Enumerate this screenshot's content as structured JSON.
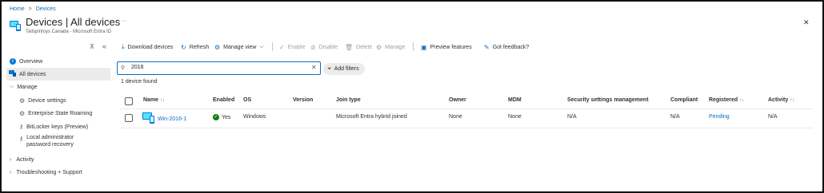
{
  "breadcrumb": {
    "home": "Home",
    "sep": ">",
    "devices": "Devices"
  },
  "header": {
    "title": "Devices | All devices",
    "more": "···",
    "subtitle": "Tailspintoys Canada - Microsoft Entra ID",
    "close": "✕"
  },
  "sidebar": {
    "pin": "⊼",
    "collapse": "«",
    "items": [
      {
        "label": "Overview"
      },
      {
        "label": "All devices"
      },
      {
        "label": "Manage"
      },
      {
        "label": "Device settings"
      },
      {
        "label": "Enterprise State Roaming"
      },
      {
        "label": "BitLocker keys (Preview)"
      },
      {
        "label": "Local administrator"
      },
      {
        "label": "password recovery"
      },
      {
        "label": "Activity"
      },
      {
        "label": "Troubleshooting + Support"
      }
    ]
  },
  "toolbar": {
    "download": "Download devices",
    "refresh": "Refresh",
    "manage_view": "Manage view",
    "enable": "Enable",
    "disable": "Disable",
    "delete": "Delete",
    "manage": "Manage",
    "preview_features": "Preview features",
    "feedback": "Got feedback?"
  },
  "search": {
    "value": "2016",
    "clear": "✕"
  },
  "filters": {
    "add_label": "Add filters"
  },
  "result_count": "1 device found",
  "table": {
    "headers": {
      "name": "Name",
      "enabled": "Enabled",
      "os": "OS",
      "version": "Version",
      "join_type": "Join type",
      "owner": "Owner",
      "mdm": "MDM",
      "security": "Security settings management",
      "compliant": "Compliant",
      "registered": "Registered",
      "activity": "Activity"
    },
    "sort_glyph": "↑↓",
    "rows": [
      {
        "name": "Win-2016-1",
        "enabled": "Yes",
        "os": "Windows",
        "version": "",
        "join_type": "Microsoft Entra hybrid joined",
        "owner": "None",
        "mdm": "None",
        "security": "N/A",
        "compliant": "N/A",
        "registered": "Pending",
        "activity": "N/A"
      }
    ]
  },
  "colors": {
    "accent": "#0f6cbd",
    "success": "#107c10",
    "text": "#323130",
    "selected_bg": "#edebe9"
  }
}
